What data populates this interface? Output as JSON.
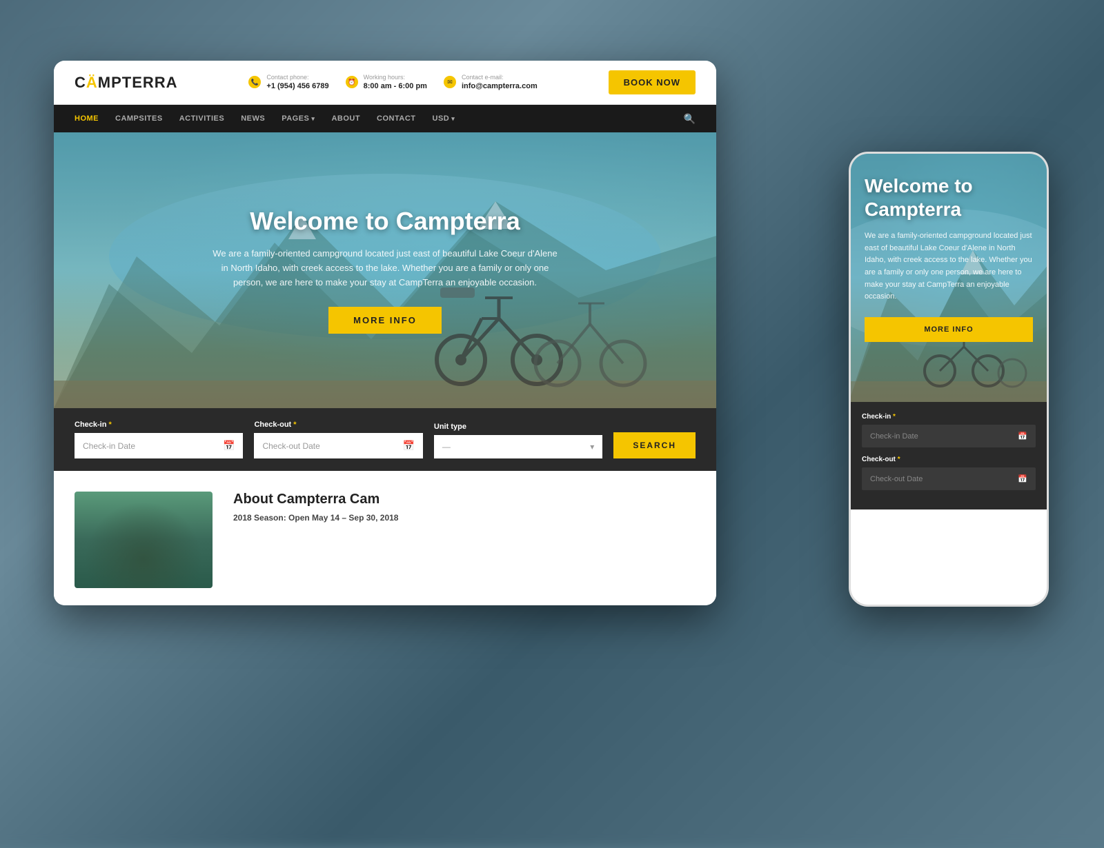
{
  "background": {
    "color": "#5a7a8a"
  },
  "desktop": {
    "header": {
      "logo": {
        "text_before": "C",
        "accent": "Ä",
        "text_after": "MPTERRA"
      },
      "contact_phone": {
        "label": "Contact phone:",
        "value": "+1 (954) 456 6789"
      },
      "working_hours": {
        "label": "Working hours:",
        "value": "8:00 am - 6:00 pm"
      },
      "contact_email": {
        "label": "Contact e-mail:",
        "value": "info@campterra.com"
      },
      "book_now_label": "BOOK NOW"
    },
    "nav": {
      "items": [
        {
          "label": "HOME",
          "active": true
        },
        {
          "label": "CAMPSITES",
          "active": false
        },
        {
          "label": "ACTIVITIES",
          "active": false
        },
        {
          "label": "NEWS",
          "active": false
        },
        {
          "label": "PAGES",
          "active": false,
          "has_arrow": true
        },
        {
          "label": "ABOUT",
          "active": false
        },
        {
          "label": "CONTACT",
          "active": false
        },
        {
          "label": "USD",
          "active": false,
          "has_arrow": true
        }
      ]
    },
    "hero": {
      "title": "Welcome to Campterra",
      "description": "We are a family-oriented campground located just east of beautiful Lake Coeur d'Alene in North Idaho, with creek access to the lake. Whether you are a family or only one person, we are here to make your stay at CampTerra an enjoyable occasion.",
      "cta_label": "MORE INFO"
    },
    "booking": {
      "checkin_label": "Check-in",
      "checkin_placeholder": "Check-in Date",
      "checkout_label": "Check-out",
      "checkout_placeholder": "Check-out Date",
      "unit_type_label": "Unit type",
      "unit_type_placeholder": "—",
      "search_label": "SEARCH"
    },
    "about": {
      "title": "About Campterra Cam",
      "season": "2018 Season: Open May 14 – Sep 30, 2018"
    }
  },
  "mobile": {
    "hero": {
      "title": "Welcome to Campterra",
      "description": "We are a family-oriented campground located just east of beautiful Lake Coeur d'Alene in North Idaho, with creek access to the lake. Whether you are a family or only one person, we are here to make your stay at CampTerra an enjoyable occasion.",
      "cta_label": "MORE INFO"
    },
    "booking": {
      "checkin_label": "Check-in",
      "checkin_required": "*",
      "checkin_placeholder": "Check-in Date",
      "checkout_label": "Check-out",
      "checkout_required": "*",
      "checkout_placeholder": "Check-out Date"
    }
  }
}
